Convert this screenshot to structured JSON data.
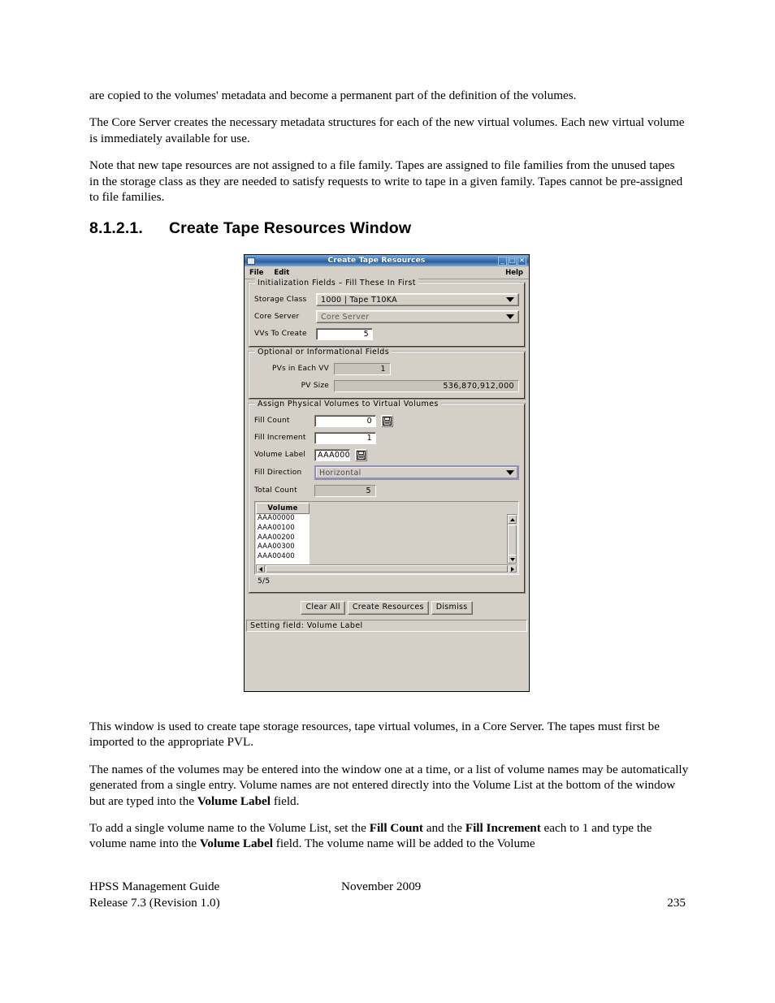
{
  "document": {
    "paragraphs_top": [
      "are copied to the volumes' metadata and become a permanent part of the definition of the volumes.",
      "The Core Server creates the necessary metadata structures for each of the new virtual volumes. Each new virtual volume is immediately available for use.",
      "Note that new tape resources are not assigned to a file family. Tapes are assigned to file families from the unused tapes in the storage class as they are needed to satisfy requests to write to tape in a given family. Tapes cannot be pre-assigned to file families."
    ],
    "heading": {
      "number": "8.1.2.1.",
      "title": "Create Tape Resources Window"
    },
    "paragraphs_bottom": [
      "This window is used to create tape storage resources, tape virtual volumes, in a Core Server. The tapes must first be imported to the appropriate PVL.",
      "The names of the volumes may be entered into the window one at a time, or a list of volume names may be automatically generated from a single entry. Volume names are not entered directly into the Volume List at the bottom of the window but are typed into the Volume Label field.",
      "To add a single volume name to the Volume List, set the Fill Count and the Fill Increment each to 1 and type the volume name into the Volume Label field. The volume name will be added to the Volume"
    ],
    "footer": {
      "guide": "HPSS Management Guide",
      "release": "Release 7.3 (Revision 1.0)",
      "date": "November 2009",
      "page": "235"
    }
  },
  "window": {
    "title": "Create Tape Resources",
    "titlebar_icon": "window-icon",
    "buttons": {
      "minimize": "_",
      "maximize": "□",
      "close": "✕"
    },
    "menubar": {
      "file": "File",
      "edit": "Edit",
      "help": "Help"
    },
    "init_group": {
      "legend": "Initialization Fields – Fill These In First",
      "storage_class": {
        "label": "Storage Class",
        "value": "1000 | Tape T10KA"
      },
      "core_server": {
        "label": "Core Server",
        "value": "Core Server"
      },
      "vvs_to_create": {
        "label": "VVs To Create",
        "value": "5"
      }
    },
    "optional_group": {
      "legend": "Optional or Informational Fields",
      "pvs_in_each_vv": {
        "label": "PVs in Each VV",
        "value": "1"
      },
      "pv_size": {
        "label": "PV Size",
        "value": "536,870,912,000"
      }
    },
    "assign_group": {
      "legend": "Assign Physical Volumes to Virtual Volumes",
      "fill_count": {
        "label": "Fill Count",
        "value": "0"
      },
      "fill_increment": {
        "label": "Fill Increment",
        "value": "1"
      },
      "volume_label": {
        "label": "Volume Label",
        "value": "AAA000"
      },
      "fill_direction": {
        "label": "Fill Direction",
        "value": "Horizontal"
      },
      "total_count": {
        "label": "Total Count",
        "value": "5"
      },
      "volume_list": {
        "column_header": "Volume",
        "rows": [
          "AAA00000",
          "AAA00100",
          "AAA00200",
          "AAA00300",
          "AAA00400"
        ],
        "count": "5/5"
      }
    },
    "actions": {
      "clear_all": "Clear All",
      "create_resources": "Create Resources",
      "dismiss": "Dismiss"
    },
    "status": "Setting field: Volume Label"
  }
}
